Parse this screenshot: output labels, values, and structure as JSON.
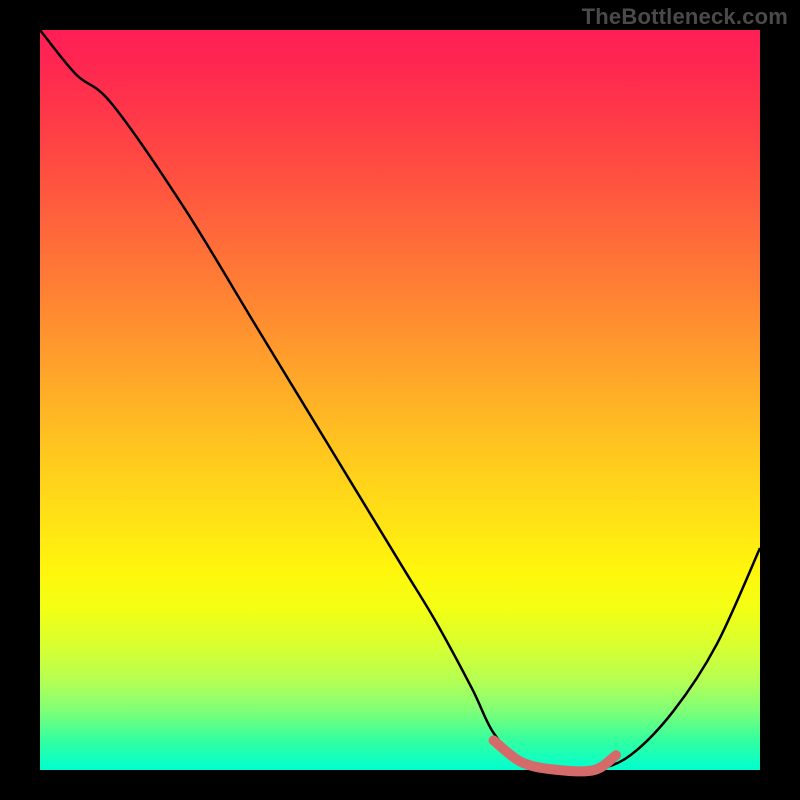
{
  "watermark": "TheBottleneck.com",
  "chart_data": {
    "type": "line",
    "title": "",
    "xlabel": "",
    "ylabel": "",
    "xlim": [
      0,
      1
    ],
    "ylim": [
      0,
      1
    ],
    "series": [
      {
        "name": "main-curve",
        "color": "#000000",
        "x": [
          0.0,
          0.05,
          0.1,
          0.2,
          0.3,
          0.4,
          0.5,
          0.55,
          0.6,
          0.63,
          0.67,
          0.72,
          0.77,
          0.82,
          0.88,
          0.94,
          1.0
        ],
        "y": [
          1.0,
          0.94,
          0.9,
          0.76,
          0.6,
          0.44,
          0.28,
          0.2,
          0.11,
          0.05,
          0.01,
          0.0,
          0.0,
          0.02,
          0.08,
          0.17,
          0.3
        ]
      },
      {
        "name": "highlight-band",
        "color": "#d56a6a",
        "x": [
          0.63,
          0.67,
          0.72,
          0.77,
          0.8
        ],
        "y": [
          0.04,
          0.01,
          0.0,
          0.0,
          0.02
        ]
      }
    ],
    "annotations": []
  }
}
